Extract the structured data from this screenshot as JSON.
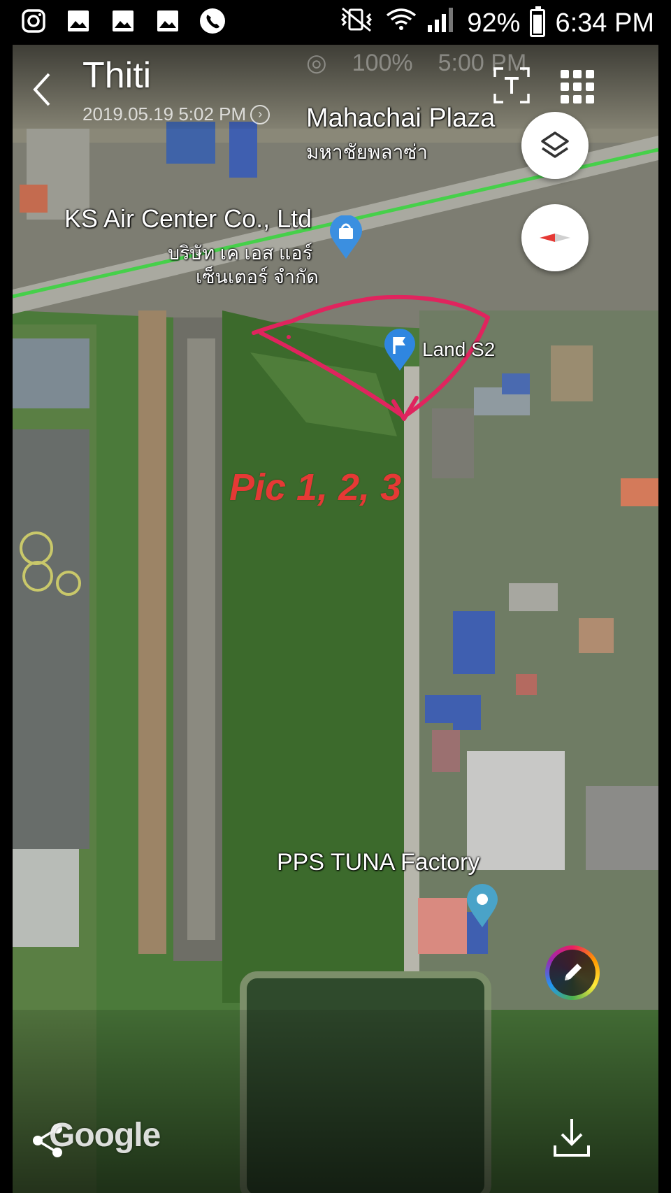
{
  "status_bar": {
    "left_icons": [
      "instagram-icon",
      "gallery-icon",
      "gallery-icon",
      "gallery-icon",
      "phone-icon"
    ],
    "right_icons": [
      "mute-vibrate-icon",
      "wifi-icon",
      "signal-icon"
    ],
    "battery": "92%",
    "time": "6:34 PM"
  },
  "header": {
    "title": "Thiti",
    "subtitle": "2019.05.19 5:02 PM"
  },
  "embedded_status": {
    "battery": "100%",
    "time": "5:00 PM"
  },
  "map": {
    "labels": {
      "plaza_en": "Mahachai Plaza",
      "plaza_th": "มหาชัยพลาซ่า",
      "ks_en": "KS Air Center Co., Ltd",
      "ks_th1": "บริษัท เค เอส แอร์",
      "ks_th2": "เซ็นเตอร์ จำกัด",
      "land": "Land S2",
      "pps": "PPS TUNA Factory"
    },
    "annotation": "Pic 1, 2, 3",
    "annotation_color": "#e53935",
    "stroke_color": "#e0245e"
  },
  "footer": {
    "logo": "Google"
  }
}
